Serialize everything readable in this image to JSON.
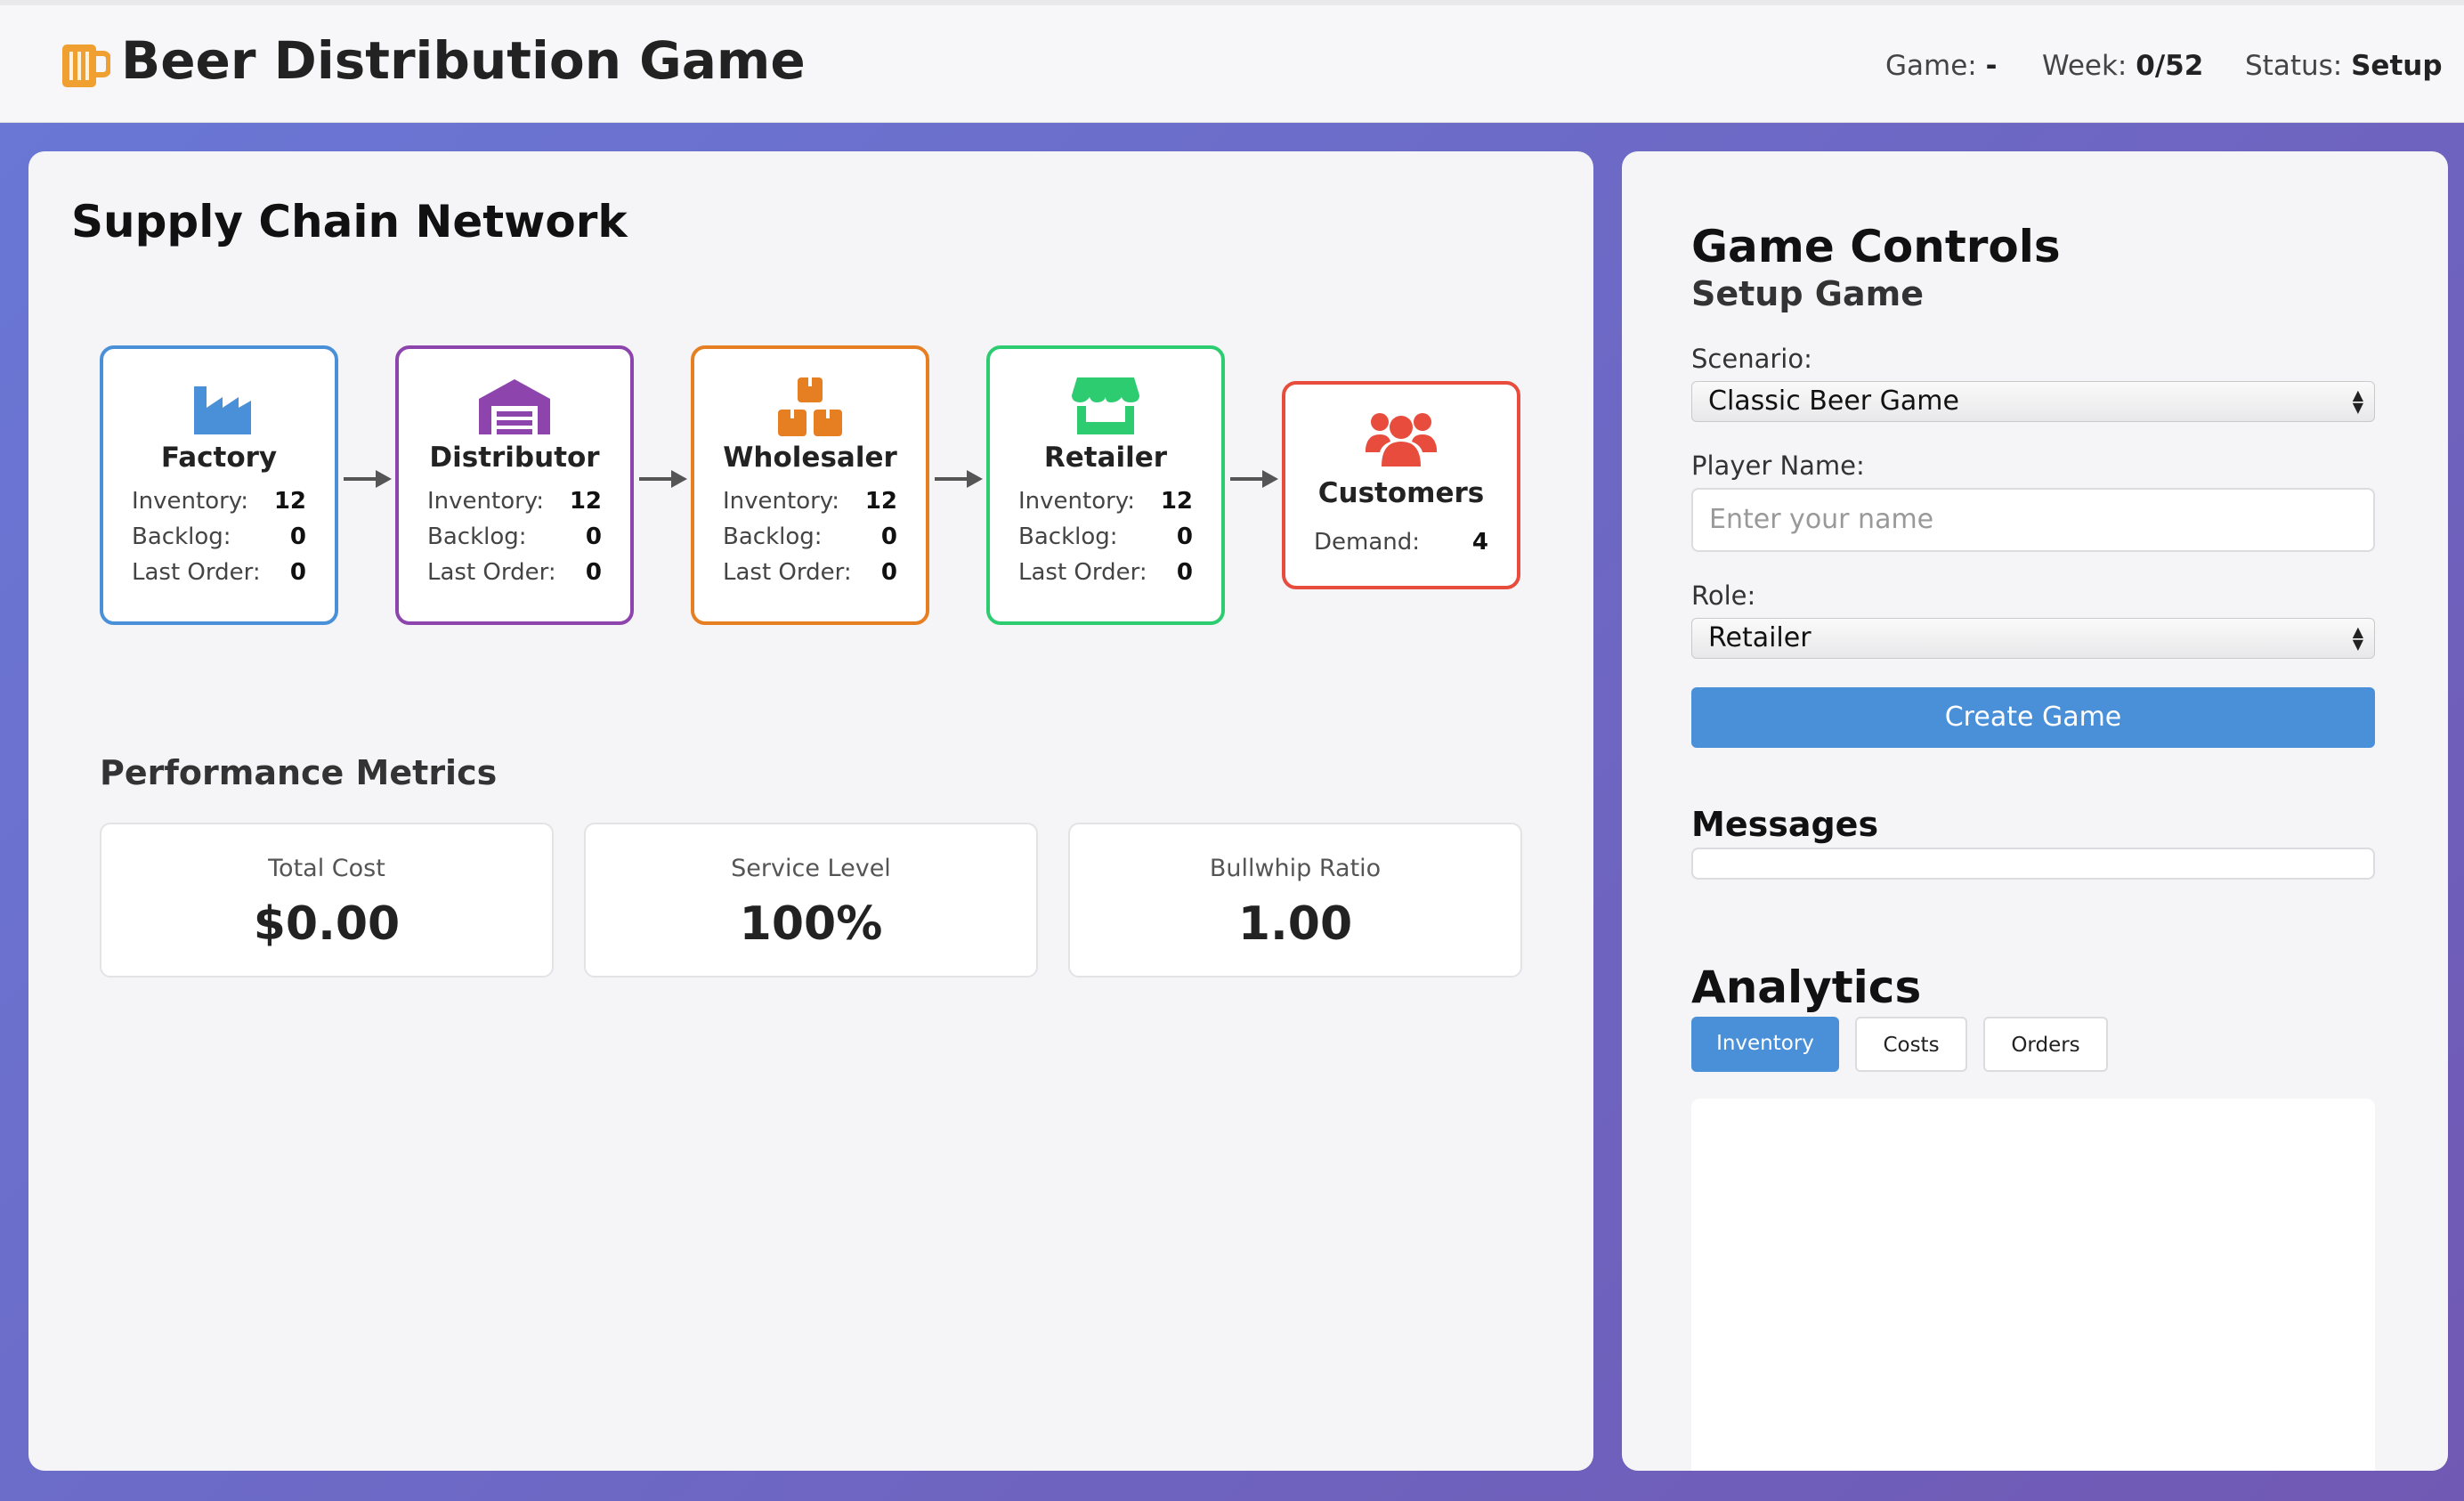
{
  "header": {
    "title": "Beer Distribution Game",
    "game_label": "Game:",
    "game_value": "-",
    "week_label": "Week:",
    "week_value": "0/52",
    "status_label": "Status:",
    "status_value": "Setup",
    "logo_icon": "beer-mug-icon"
  },
  "supply_chain": {
    "title": "Supply Chain Network",
    "nodes": [
      {
        "name": "Factory",
        "icon": "factory-icon",
        "color": "#4a90d9",
        "inventory_label": "Inventory:",
        "inventory": "12",
        "backlog_label": "Backlog:",
        "backlog": "0",
        "last_order_label": "Last Order:",
        "last_order": "0"
      },
      {
        "name": "Distributor",
        "icon": "warehouse-icon",
        "color": "#8e44ad",
        "inventory_label": "Inventory:",
        "inventory": "12",
        "backlog_label": "Backlog:",
        "backlog": "0",
        "last_order_label": "Last Order:",
        "last_order": "0"
      },
      {
        "name": "Wholesaler",
        "icon": "boxes-icon",
        "color": "#e67e22",
        "inventory_label": "Inventory:",
        "inventory": "12",
        "backlog_label": "Backlog:",
        "backlog": "0",
        "last_order_label": "Last Order:",
        "last_order": "0"
      },
      {
        "name": "Retailer",
        "icon": "store-icon",
        "color": "#2ecc71",
        "inventory_label": "Inventory:",
        "inventory": "12",
        "backlog_label": "Backlog:",
        "backlog": "0",
        "last_order_label": "Last Order:",
        "last_order": "0"
      }
    ],
    "customers": {
      "name": "Customers",
      "icon": "users-icon",
      "color": "#e74c3c",
      "demand_label": "Demand:",
      "demand": "4"
    }
  },
  "metrics": {
    "title": "Performance Metrics",
    "items": [
      {
        "label": "Total Cost",
        "value": "$0.00"
      },
      {
        "label": "Service Level",
        "value": "100%"
      },
      {
        "label": "Bullwhip Ratio",
        "value": "1.00"
      }
    ]
  },
  "controls": {
    "title": "Game Controls",
    "subtitle": "Setup Game",
    "scenario_label": "Scenario:",
    "scenario_value": "Classic Beer Game",
    "player_label": "Player Name:",
    "player_placeholder": "Enter your name",
    "role_label": "Role:",
    "role_value": "Retailer",
    "create_button": "Create Game"
  },
  "messages": {
    "title": "Messages"
  },
  "analytics": {
    "title": "Analytics",
    "tabs": [
      "Inventory",
      "Costs",
      "Orders"
    ],
    "active_tab": "Inventory"
  },
  "colors": {
    "accent": "#4a90d9",
    "background_start": "#6a78d6",
    "background_end": "#7059b4"
  }
}
